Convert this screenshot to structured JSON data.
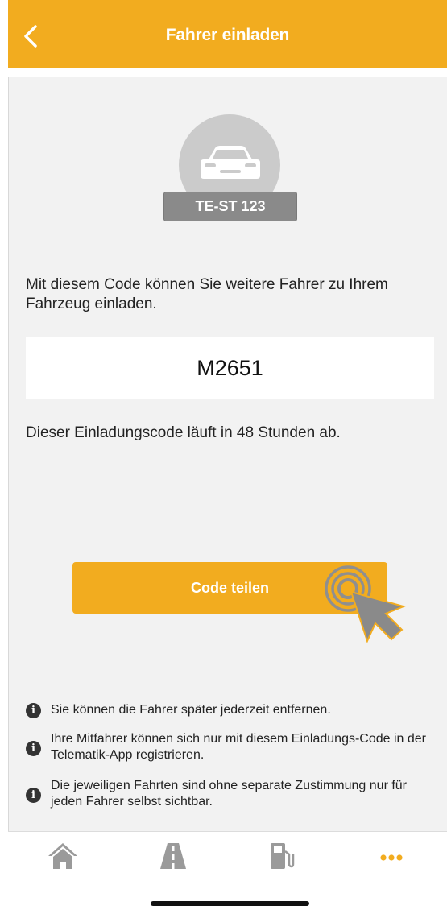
{
  "header": {
    "title": "Fahrer einladen"
  },
  "vehicle": {
    "plate": "TE-ST 123"
  },
  "invite": {
    "description": "Mit diesem Code können Sie weitere Fahrer zu Ihrem Fahrzeug einladen.",
    "code": "M2651",
    "expiry": "Dieser Einladungscode läuft in 48 Stunden ab.",
    "share_label": "Code teilen"
  },
  "info": [
    {
      "text": "Sie können die Fahrer später jederzeit entfernen."
    },
    {
      "text": "Ihre Mitfahrer können sich nur mit diesem Einladungs-Code in der Telematik-App registrieren."
    },
    {
      "text": "Die jeweiligen Fahrten sind ohne separate Zustimmung nur für jeden Fahrer selbst sichtbar."
    }
  ],
  "tabs": [
    {
      "icon": "home-icon",
      "active": false
    },
    {
      "icon": "road-icon",
      "active": false
    },
    {
      "icon": "fuel-icon",
      "active": false
    },
    {
      "icon": "more-icon",
      "active": true
    }
  ],
  "colors": {
    "accent": "#f2ac1f",
    "inactive_icon": "#9a9a9a",
    "background": "#f2f2f2"
  }
}
